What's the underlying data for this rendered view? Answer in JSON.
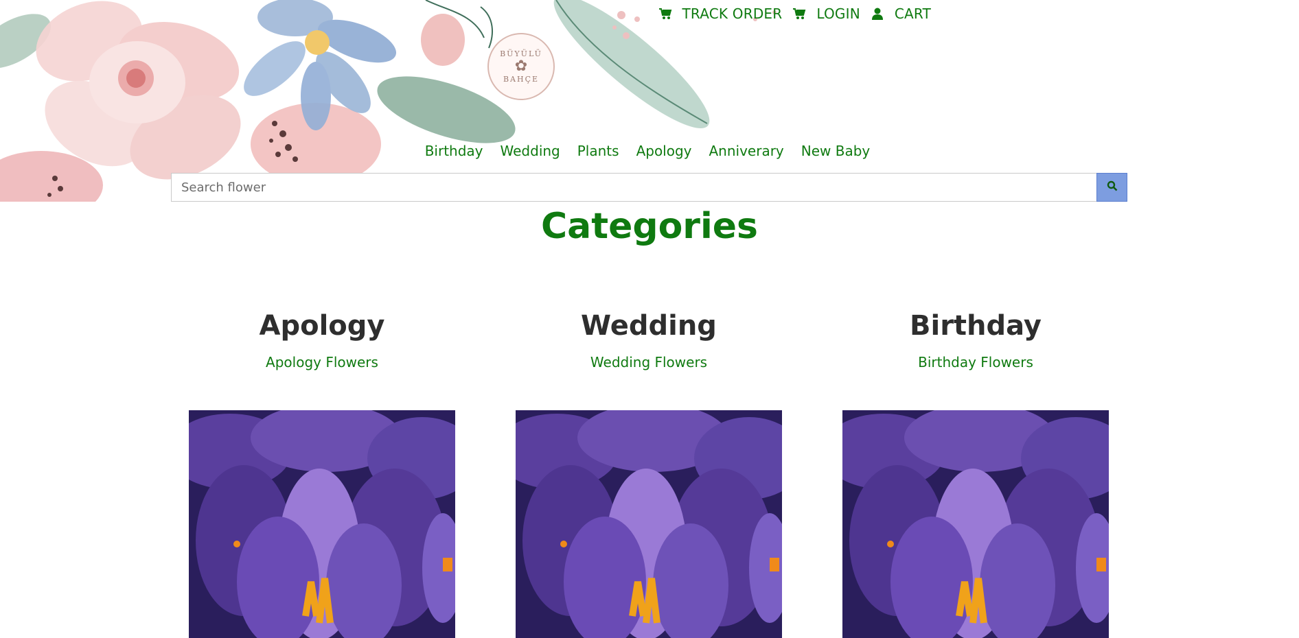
{
  "topnav": [
    {
      "label": "TRACK ORDER",
      "icon": "cart-icon"
    },
    {
      "label": "LOGIN",
      "icon": "cart-icon"
    },
    {
      "label": "CART",
      "icon": "user-icon"
    }
  ],
  "logo": {
    "line1": "BÜYÜLÜ",
    "line2": "BAHÇE"
  },
  "categories_nav": [
    "Birthday",
    "Wedding",
    "Plants",
    "Apology",
    "Anniverary",
    "New Baby"
  ],
  "search": {
    "placeholder": "Search flower",
    "button_icon": "search-icon"
  },
  "section_title": "Categories",
  "cards": [
    {
      "title": "Apology",
      "link": "Apology Flowers",
      "image": "purple-crocus-flower-photo"
    },
    {
      "title": "Wedding",
      "link": "Wedding Flowers",
      "image": "purple-crocus-flower-photo"
    },
    {
      "title": "Birthday",
      "link": "Birthday Flowers",
      "image": "purple-crocus-flower-photo"
    }
  ],
  "colors": {
    "accent_green": "#0f7a10",
    "search_button": "#7d9de0",
    "heading": "#2e2e2e"
  }
}
